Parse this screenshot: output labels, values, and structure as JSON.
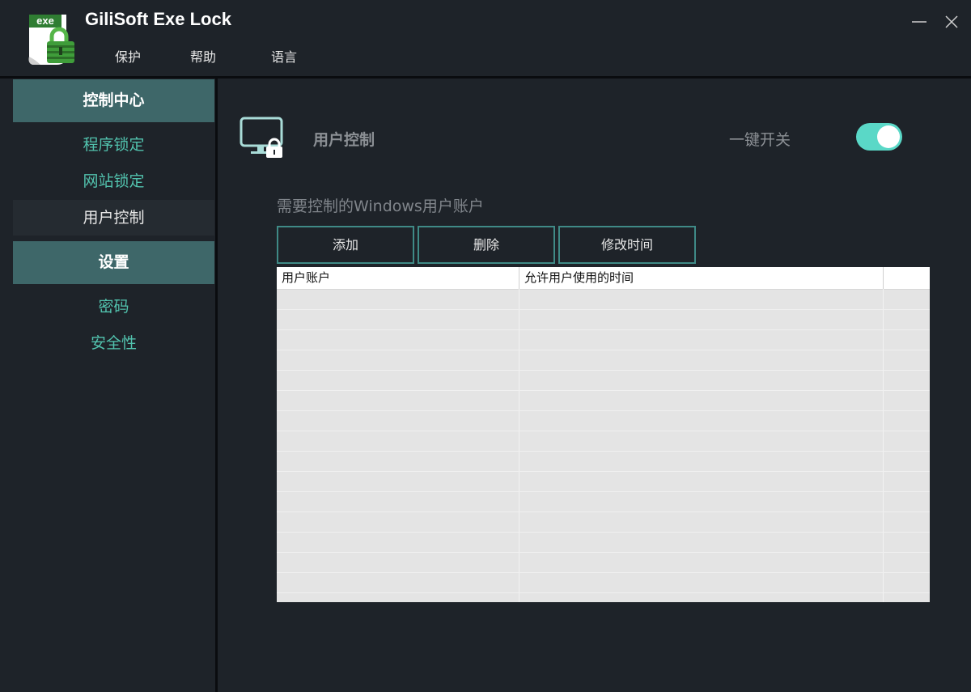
{
  "app": {
    "title": "GiliSoft Exe Lock",
    "logo_text": "exe"
  },
  "menu": {
    "protect": "保护",
    "help": "帮助",
    "language": "语言"
  },
  "window_controls": {
    "minimize": "minimize-icon",
    "close": "close-icon"
  },
  "sidebar": {
    "control_center": "控制中心",
    "program_lock": "程序锁定",
    "website_lock": "网站锁定",
    "user_control": "用户控制",
    "settings": "设置",
    "password": "密码",
    "security": "安全性"
  },
  "main": {
    "section_title": "用户控制",
    "toggle_label": "一键开关",
    "toggle_on": true,
    "subtitle": "需要控制的Windows用户账户",
    "buttons": {
      "add": "添加",
      "delete": "删除",
      "modify_time": "修改时间"
    },
    "table": {
      "columns": [
        "用户账户",
        "允许用户使用的时间"
      ],
      "rows": []
    }
  },
  "colors": {
    "accent": "#3e6769",
    "teal_text": "#52c3ae",
    "toggle": "#5ad8c7",
    "background": "#1e2329"
  }
}
